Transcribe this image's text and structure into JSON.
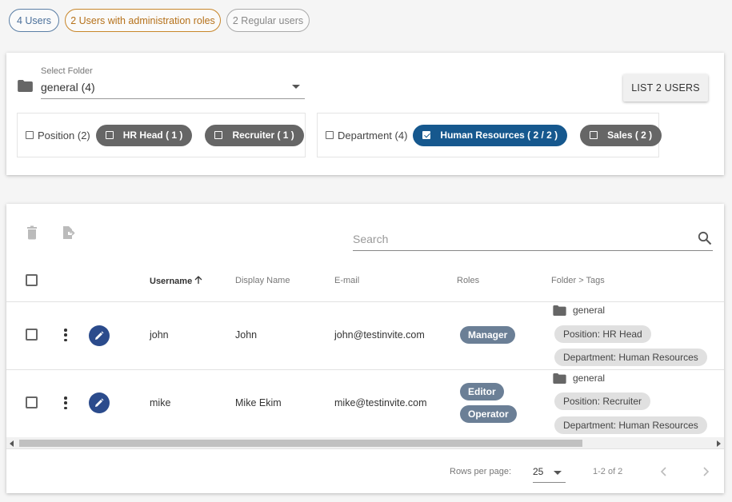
{
  "filters": {
    "all_users": "4 Users",
    "admin_users": "2 Users with administration roles",
    "regular_users": "2 Regular users"
  },
  "folder_select": {
    "label": "Select Folder",
    "value": "general (4)"
  },
  "list_button": "LIST 2 USERS",
  "tag_groups": {
    "position": {
      "label": "Position (2)",
      "tags": [
        "HR Head ( 1 )",
        "Recruiter ( 1 )"
      ]
    },
    "department": {
      "label": "Department (4)",
      "tags": [
        "Human Resources ( 2 / 2 )",
        "Sales ( 2 )"
      ]
    }
  },
  "search": {
    "placeholder": "Search"
  },
  "table": {
    "columns": [
      "Username",
      "Display Name",
      "E-mail",
      "Roles",
      "Folder > Tags"
    ],
    "sorted_column": "Username",
    "sort_direction": "ascending",
    "rows": [
      {
        "username": "john",
        "display_name": "John",
        "email": "john@testinvite.com",
        "roles": [
          "Manager"
        ],
        "folder": "general",
        "tags": [
          "Position: HR Head",
          "Department: Human Resources"
        ]
      },
      {
        "username": "mike",
        "display_name": "Mike Ekim",
        "email": "mike@testinvite.com",
        "roles": [
          "Editor",
          "Operator"
        ],
        "folder": "general",
        "tags": [
          "Position: Recruiter",
          "Department: Human Resources"
        ]
      }
    ]
  },
  "pagination": {
    "rows_per_page_label": "Rows per page:",
    "rows_per_page": "25",
    "range": "1-2 of 2"
  },
  "colors": {
    "selected_tag": "#16588e",
    "unselected_tag": "#666666",
    "role_chip": "#6b7f96",
    "edit_button": "#2b4b8c",
    "admin_filter": "#c8862a",
    "all_filter": "#5b7fa6"
  }
}
